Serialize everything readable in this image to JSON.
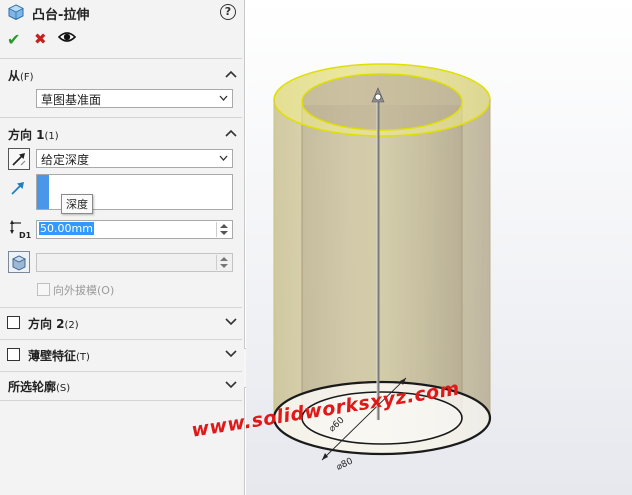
{
  "feature": {
    "title": "凸台-拉伸",
    "help_label": "?"
  },
  "actions": {
    "ok_icon": "check-icon",
    "cancel_icon": "close-icon",
    "preview_icon": "eye-icon"
  },
  "from_section": {
    "title": "从",
    "key": "(F)",
    "start_condition": "草图基准面"
  },
  "direction1": {
    "title": "方向 1",
    "key": "(1)",
    "end_condition": "给定深度",
    "tooltip": "深度",
    "depth": "50.00mm",
    "draft_outward_label": "向外拔模",
    "draft_outward_key": "(O)"
  },
  "direction2": {
    "title": "方向 2",
    "key": "(2)",
    "checked": false
  },
  "thin_feature": {
    "title": "薄壁特征",
    "key": "(T)",
    "checked": false
  },
  "selected_contours": {
    "title": "所选轮廓",
    "key": "(S)"
  },
  "model": {
    "type": "hollow-cylinder-extrude-preview",
    "body_color": "#d9cfa6",
    "edge_color": "#e8e800",
    "outline_color": "#222222"
  },
  "watermark": "www.solidworksxyz.com"
}
